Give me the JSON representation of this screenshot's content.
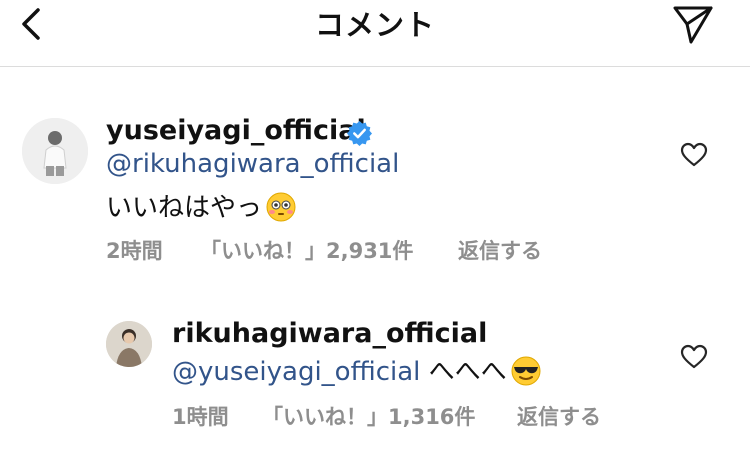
{
  "header": {
    "title": "コメント",
    "back_icon": "chevron-left-icon",
    "send_icon": "paper-plane-icon"
  },
  "comments": [
    {
      "username": "yuseiyagi_official",
      "verified": true,
      "mention": "@rikuhagiwara_official",
      "body": "いいねはやっ",
      "emoji": "flushed-face-emoji",
      "time": "2時間",
      "likes": "「いいね！」2,931件",
      "reply": "返信する"
    },
    {
      "username": "rikuhagiwara_official",
      "verified": false,
      "mention": "@yuseiyagi_official",
      "body": " へへへ",
      "emoji": "sunglasses-face-emoji",
      "time": "1時間",
      "likes": "「いいね！」1,316件",
      "reply": "返信する"
    }
  ],
  "colors": {
    "mention": "#32548a",
    "verified": "#3797f0",
    "meta": "#8e8e8e"
  }
}
